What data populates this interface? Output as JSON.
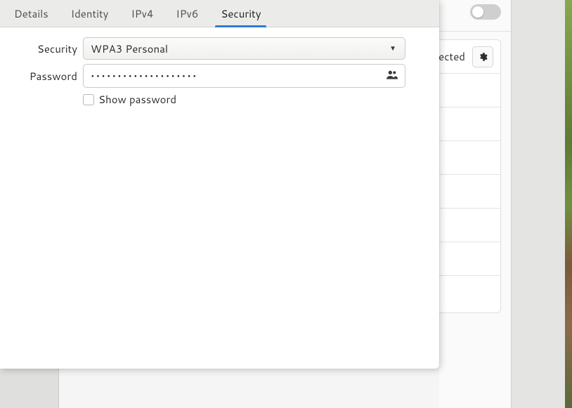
{
  "background_window": {
    "toggle_state": "off",
    "connected_text": "ected",
    "gear_title": "Settings"
  },
  "dialog": {
    "tabs": [
      {
        "label": "Details",
        "active": false
      },
      {
        "label": "Identity",
        "active": false
      },
      {
        "label": "IPv4",
        "active": false
      },
      {
        "label": "IPv6",
        "active": false
      },
      {
        "label": "Security",
        "active": true
      }
    ],
    "security_row": {
      "label": "Security",
      "value": "WPA3 Personal"
    },
    "password_row": {
      "label": "Password",
      "value": "••••••••••••••••••••"
    },
    "show_password": {
      "label": "Show password",
      "checked": false
    }
  }
}
